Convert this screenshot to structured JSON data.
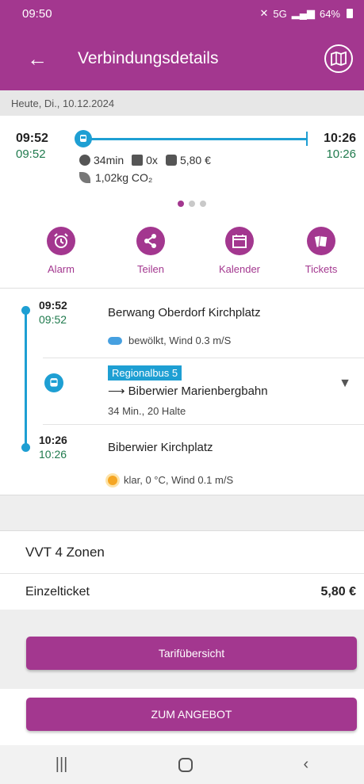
{
  "status": {
    "time": "09:50",
    "battery": "64%",
    "signal": "5G"
  },
  "header": {
    "title": "Verbindungsdetails"
  },
  "date": "Heute, Di., 10.12.2024",
  "summary": {
    "dep_planned": "09:52",
    "dep_actual": "09:52",
    "arr_planned": "10:26",
    "arr_actual": "10:26",
    "duration": "34min",
    "transfers": "0x",
    "price": "5,80 €",
    "co2": "1,02kg CO₂"
  },
  "actions": [
    {
      "label": "Alarm"
    },
    {
      "label": "Teilen"
    },
    {
      "label": "Kalender"
    },
    {
      "label": "Tickets"
    }
  ],
  "journey": {
    "start": {
      "time_planned": "09:52",
      "time_actual": "09:52",
      "name": "Berwang Oberdorf Kirchplatz",
      "weather": "bewölkt, Wind 0.3 m/S"
    },
    "leg": {
      "line": "Regionalbus 5",
      "direction": "⟶ Biberwier Marienbergbahn",
      "details": "34 Min., 20 Halte"
    },
    "end": {
      "time_planned": "10:26",
      "time_actual": "10:26",
      "name": "Biberwier Kirchplatz",
      "weather": "klar, 0 °C, Wind 0.1 m/S"
    }
  },
  "tariff": {
    "zones": "VVT 4 Zonen",
    "ticket_name": "Einzelticket",
    "ticket_price": "5,80 €"
  },
  "buttons": {
    "overview": "Tarifübersicht",
    "offer": "ZUM ANGEBOT"
  },
  "colors": {
    "primary": "#a3378f",
    "line": "#1e9fd3",
    "realtime": "#1f7a4d"
  }
}
